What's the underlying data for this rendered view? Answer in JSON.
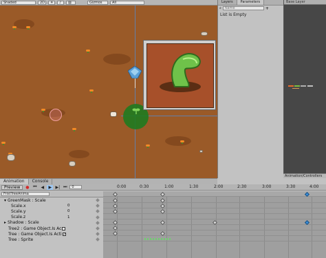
{
  "toolbar": {
    "shading_mode": "Shaded",
    "mode_2d": "2D",
    "gizmos": "Gizmos",
    "gizmos_search": "All"
  },
  "layers_panel": {
    "tab_layers": "Layers",
    "tab_parameters": "Parameters",
    "search_placeholder": "Name",
    "list_empty": "List is Empty"
  },
  "graph_panel": {
    "header": "Base Layer"
  },
  "scene_tabs": {
    "animation": "Animation",
    "console": "Console"
  },
  "anim_controller_tab": "Animation/Controllers",
  "animation": {
    "preview_label": "Preview",
    "frame_value": "0",
    "clip_name": "FristTreeAnima",
    "time_ticks": [
      "0:00",
      "0:30",
      "1:00",
      "1:30",
      "2:00",
      "2:30",
      "3:00",
      "3:30",
      "4:00"
    ],
    "properties": [
      {
        "label": "GreenMask : Scale",
        "value": "",
        "indent": 0
      },
      {
        "label": "Scale.x",
        "value": "0",
        "indent": 1
      },
      {
        "label": "Scale.y",
        "value": "0",
        "indent": 1
      },
      {
        "label": "Scale.z",
        "value": "1",
        "indent": 1
      },
      {
        "label": "Shadow : Scale",
        "value": "",
        "indent": 0
      },
      {
        "label": "Tree2 : Game Object.Is Ac",
        "value": "",
        "indent": 0
      },
      {
        "label": "Tree : Game Object.Is Acti",
        "value": "",
        "indent": 0
      },
      {
        "label": "Tree : Sprite",
        "value": "",
        "indent": 0
      }
    ]
  },
  "colors": {
    "scene_ground": "#9a5a28",
    "leaf_green": "#6fc24a",
    "selection_blue": "#3b8fd9",
    "shadow_green": "#1f7a1f"
  }
}
